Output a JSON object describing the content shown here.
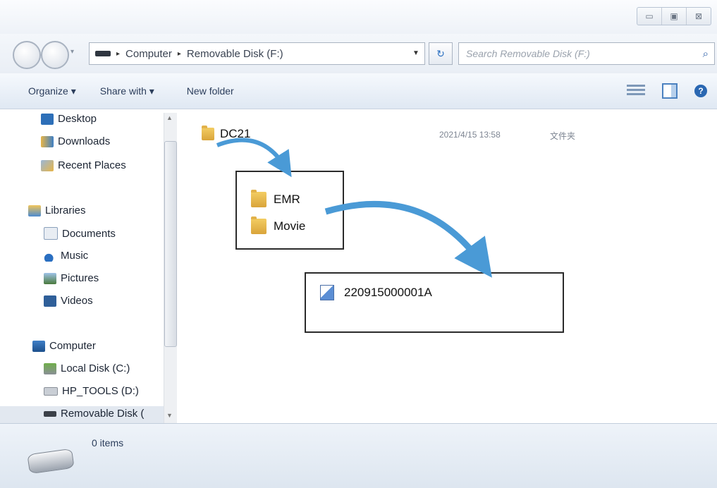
{
  "window": {
    "controls": {
      "minimize": "▭",
      "maximize": "▣",
      "close": "⊠"
    }
  },
  "address_bar": {
    "segments": [
      "Computer",
      "Removable Disk (F:)"
    ],
    "separator": "▸",
    "search_placeholder": "Search Removable Disk (F:)"
  },
  "toolbar": {
    "organize": "Organize ▾",
    "share_with": "Share with ▾",
    "new_folder": "New folder"
  },
  "nav_pane": {
    "favorites": [
      {
        "label": "Desktop",
        "icon": "desktop-icon"
      },
      {
        "label": "Downloads",
        "icon": "downloads-icon"
      },
      {
        "label": "Recent Places",
        "icon": "recent-places-icon"
      }
    ],
    "libraries": {
      "label": "Libraries",
      "items": [
        {
          "label": "Documents",
          "icon": "documents-icon"
        },
        {
          "label": "Music",
          "icon": "music-icon"
        },
        {
          "label": "Pictures",
          "icon": "pictures-icon"
        },
        {
          "label": "Videos",
          "icon": "videos-icon"
        }
      ]
    },
    "computer": {
      "label": "Computer",
      "items": [
        {
          "label": "Local Disk (C:)",
          "icon": "local-disk-icon"
        },
        {
          "label": "HP_TOOLS (D:)",
          "icon": "drive-icon"
        },
        {
          "label": "Removable Disk (",
          "icon": "removable-disk-icon",
          "selected": true
        }
      ]
    }
  },
  "content": {
    "root_folder": {
      "name": "DC21",
      "date": "2021/4/15 13:58",
      "type": "文件夹"
    },
    "subfolders": [
      "EMR",
      "Movie"
    ],
    "file": "220915000001A"
  },
  "status": {
    "item_count": "0 items"
  },
  "colors": {
    "arrow": "#4a9ad6",
    "toolbar_text": "#2c3e5c"
  }
}
